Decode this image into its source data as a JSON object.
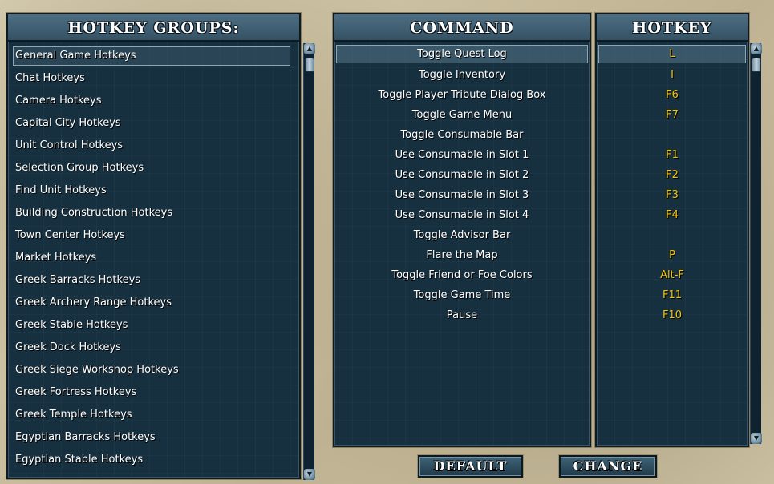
{
  "groups": {
    "header": "HOTKEY GROUPS:",
    "items": [
      "General Game Hotkeys",
      "Chat Hotkeys",
      "Camera Hotkeys",
      "Capital City Hotkeys",
      "Unit Control Hotkeys",
      "Selection Group Hotkeys",
      "Find Unit Hotkeys",
      "Building Construction Hotkeys",
      "Town Center Hotkeys",
      "Market Hotkeys",
      "Greek Barracks Hotkeys",
      "Greek Archery Range Hotkeys",
      "Greek Stable Hotkeys",
      "Greek Dock Hotkeys",
      "Greek Siege Workshop Hotkeys",
      "Greek Fortress Hotkeys",
      "Greek Temple Hotkeys",
      "Egyptian Barracks Hotkeys",
      "Egyptian Stable Hotkeys"
    ],
    "selected_index": 0
  },
  "commands": {
    "command_header": "COMMAND",
    "hotkey_header": "HOTKEY",
    "rows": [
      {
        "command": "Toggle Quest Log",
        "hotkey": "L"
      },
      {
        "command": "Toggle Inventory",
        "hotkey": "I"
      },
      {
        "command": "Toggle Player Tribute Dialog Box",
        "hotkey": "F6"
      },
      {
        "command": "Toggle Game Menu",
        "hotkey": "F7"
      },
      {
        "command": "Toggle Consumable Bar",
        "hotkey": ""
      },
      {
        "command": "Use Consumable in Slot 1",
        "hotkey": "F1"
      },
      {
        "command": "Use Consumable in Slot 2",
        "hotkey": "F2"
      },
      {
        "command": "Use Consumable in Slot 3",
        "hotkey": "F3"
      },
      {
        "command": "Use Consumable in Slot 4",
        "hotkey": "F4"
      },
      {
        "command": "Toggle Advisor Bar",
        "hotkey": ""
      },
      {
        "command": "Flare the Map",
        "hotkey": "P"
      },
      {
        "command": "Toggle Friend or Foe Colors",
        "hotkey": "Alt-F"
      },
      {
        "command": "Toggle Game Time",
        "hotkey": "F11"
      },
      {
        "command": "Pause",
        "hotkey": "F10"
      }
    ],
    "selected_index": 0
  },
  "buttons": {
    "default_label": "DEFAULT",
    "change_label": "CHANGE"
  },
  "icons": {
    "scroll_up": "scroll-up-arrow-icon",
    "scroll_down": "scroll-down-arrow-icon"
  },
  "colors": {
    "hotkey_text": "#f5c400",
    "panel_bg": "#16303f",
    "header_bg": "#4d6e83"
  }
}
